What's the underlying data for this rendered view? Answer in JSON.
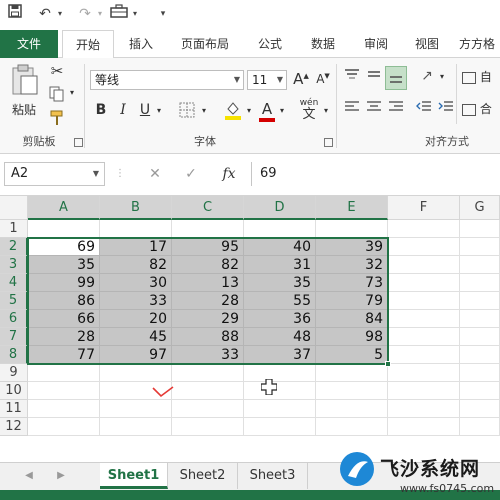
{
  "ribbon_tabs": [
    "文件",
    "开始",
    "插入",
    "页面布局",
    "公式",
    "数据",
    "审阅",
    "视图",
    "方方格"
  ],
  "clipboard": {
    "paste_label": "粘贴",
    "group_label": "剪贴板"
  },
  "font": {
    "name": "等线",
    "size": "11",
    "group_label": "字体",
    "grow": "A",
    "shrink": "A",
    "bold": "B",
    "italic": "I",
    "underline": "U",
    "color_a": "A",
    "phonetic": "wén"
  },
  "alignment": {
    "group_label": "对齐方式",
    "wrap_label": "自",
    "merge_label": "合"
  },
  "formula_bar": {
    "name_box": "A2",
    "fx": "fx",
    "value": "69"
  },
  "columns": [
    "A",
    "B",
    "C",
    "D",
    "E",
    "F",
    "G"
  ],
  "rows": [
    "1",
    "2",
    "3",
    "4",
    "5",
    "6",
    "7",
    "8",
    "9",
    "10",
    "11",
    "12"
  ],
  "table": [
    [
      "69",
      "17",
      "95",
      "40",
      "39"
    ],
    [
      "35",
      "82",
      "82",
      "31",
      "32"
    ],
    [
      "99",
      "30",
      "13",
      "35",
      "73"
    ],
    [
      "86",
      "33",
      "28",
      "55",
      "79"
    ],
    [
      "66",
      "20",
      "29",
      "36",
      "84"
    ],
    [
      "28",
      "45",
      "88",
      "48",
      "98"
    ],
    [
      "77",
      "97",
      "33",
      "37",
      "5"
    ]
  ],
  "sheets": [
    "Sheet1",
    "Sheet2",
    "Sheet3"
  ],
  "watermark": {
    "brand": "飞沙系统网",
    "site": "www.fs0745.com"
  },
  "colors": {
    "accent": "#217346",
    "selection": "#c6c6c6"
  }
}
